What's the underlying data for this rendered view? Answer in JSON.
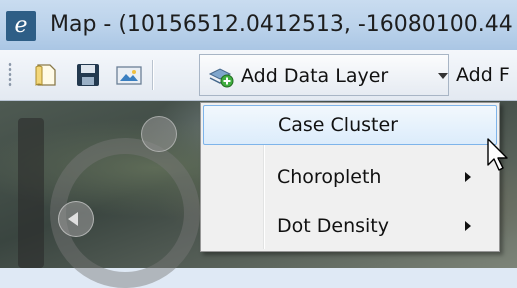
{
  "window": {
    "title": "Map - (10156512.0412513, -16080100.44",
    "app_icon_letter": "e"
  },
  "toolbar": {
    "icons": [
      "open-icon",
      "save-icon",
      "image-icon"
    ],
    "add_data_layer_label": "Add Data Layer",
    "next_button_label": "Add F"
  },
  "menu": {
    "items": [
      {
        "label": "Case Cluster",
        "has_submenu": false,
        "highlighted": true
      },
      {
        "label": "Choropleth",
        "has_submenu": true,
        "highlighted": false
      },
      {
        "label": "Dot Density",
        "has_submenu": true,
        "highlighted": false
      }
    ]
  },
  "colors": {
    "highlight_border": "#7eb4ea",
    "title_bar": "#b9d1ea",
    "menu_bg": "#f0f0f0"
  }
}
